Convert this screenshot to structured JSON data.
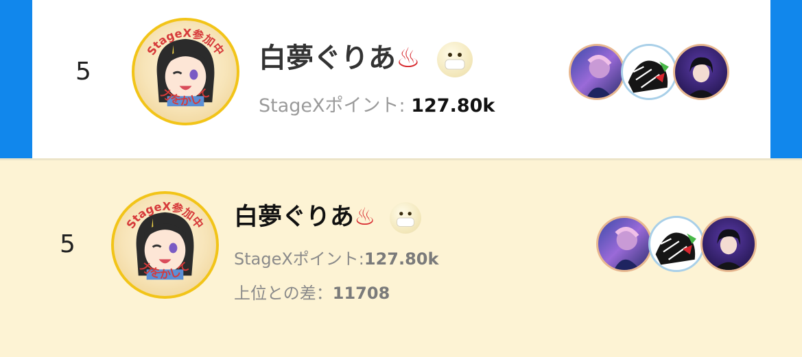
{
  "top_card": {
    "rank": "5",
    "name": "白夢ぐりあ",
    "name_emoji_1": "♨",
    "points_label": "StageXポイント: ",
    "points_value": "127.80k",
    "avatar_badge_top": "StageX参加中",
    "avatar_badge_bottom": "力をかして"
  },
  "bottom_card": {
    "rank": "5",
    "name": "白夢ぐりあ",
    "name_emoji_1": "♨",
    "points_label": "StageXポイント:",
    "points_value": "127.80k",
    "gap_label": "上位との差：",
    "gap_value": "11708",
    "avatar_badge_top": "StageX参加中",
    "avatar_badge_bottom": "力をかして"
  },
  "supporters": [
    "supporter-1",
    "supporter-2",
    "supporter-3"
  ],
  "colors": {
    "accent_blue": "#1187ec",
    "highlight_bg": "#fdf3d4",
    "avatar_ring": "#f2c418",
    "onsen_red": "#d7282d"
  }
}
